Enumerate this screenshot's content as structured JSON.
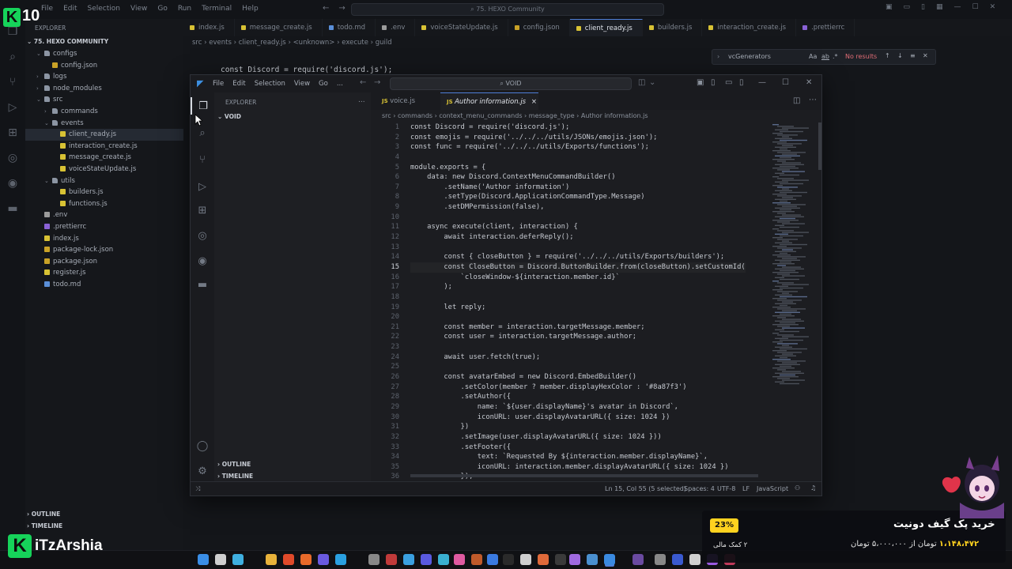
{
  "back_window": {
    "menu": [
      "File",
      "Edit",
      "Selection",
      "View",
      "Go",
      "Run",
      "Terminal",
      "Help"
    ],
    "search": "75. HEXO Community",
    "explorer_header": "EXPLORER",
    "project": "75. HEXO COMMUNITY",
    "tree": [
      {
        "label": "configs",
        "type": "folder",
        "depth": 1,
        "open": true
      },
      {
        "label": "config.json",
        "type": "json",
        "depth": 2
      },
      {
        "label": "logs",
        "type": "folder",
        "depth": 1
      },
      {
        "label": "node_modules",
        "type": "folder",
        "depth": 1
      },
      {
        "label": "src",
        "type": "folder",
        "depth": 1,
        "open": true
      },
      {
        "label": "commands",
        "type": "folder",
        "depth": 2
      },
      {
        "label": "events",
        "type": "folder",
        "depth": 2,
        "open": true
      },
      {
        "label": "client_ready.js",
        "type": "js",
        "depth": 3,
        "selected": true
      },
      {
        "label": "interaction_create.js",
        "type": "js",
        "depth": 3
      },
      {
        "label": "message_create.js",
        "type": "js",
        "depth": 3
      },
      {
        "label": "voiceStateUpdate.js",
        "type": "js",
        "depth": 3
      },
      {
        "label": "utils",
        "type": "folder",
        "depth": 2,
        "open": true
      },
      {
        "label": "builders.js",
        "type": "js",
        "depth": 3
      },
      {
        "label": "functions.js",
        "type": "js",
        "depth": 3
      },
      {
        "label": ".env",
        "type": "env",
        "depth": 1
      },
      {
        "label": ".prettierrc",
        "type": "other",
        "depth": 1
      },
      {
        "label": "index.js",
        "type": "js",
        "depth": 1
      },
      {
        "label": "package-lock.json",
        "type": "json",
        "depth": 1
      },
      {
        "label": "package.json",
        "type": "json",
        "depth": 1
      },
      {
        "label": "register.js",
        "type": "js",
        "depth": 1
      },
      {
        "label": "todo.md",
        "type": "md",
        "depth": 1
      }
    ],
    "outline": "OUTLINE",
    "timeline": "TIMELINE",
    "tabs": [
      {
        "label": "index.js",
        "type": "js"
      },
      {
        "label": "message_create.js",
        "type": "js"
      },
      {
        "label": "todo.md",
        "type": "md"
      },
      {
        "label": ".env",
        "type": "env"
      },
      {
        "label": "voiceStateUpdate.js",
        "type": "js"
      },
      {
        "label": "config.json",
        "type": "json"
      },
      {
        "label": "client_ready.js",
        "type": "js",
        "active": true
      },
      {
        "label": "builders.js",
        "type": "js"
      },
      {
        "label": "interaction_create.js",
        "type": "js"
      },
      {
        "label": ".prettierrc",
        "type": "other"
      }
    ],
    "breadcrumb": [
      "src",
      "events",
      "client_ready.js",
      "<unknown>",
      "execute",
      "guild"
    ],
    "code_line": "const Discord = require('discord.js');",
    "find": {
      "query": "vcGenerators",
      "case": "Aa",
      "word": "ab",
      "regex": ".*",
      "result": "No results"
    }
  },
  "front_window": {
    "menu": [
      "File",
      "Edit",
      "Selection",
      "View",
      "Go"
    ],
    "more": "...",
    "search": "VOID",
    "explorer_header": "EXPLORER",
    "explorer_more": "...",
    "root": "VOID",
    "outline": "OUTLINE",
    "timeline": "TIMELINE",
    "tabs": [
      {
        "label": "voice.js",
        "active": false
      },
      {
        "label": "Author information.js",
        "active": true,
        "close": "×"
      }
    ],
    "breadcrumb": [
      "src",
      "commands",
      "context_menu_commands",
      "message_type",
      "Author information.js"
    ],
    "lines": [
      {
        "n": "1",
        "t": "const Discord = require('discord.js');"
      },
      {
        "n": "2",
        "t": "const emojis = require('../../../utils/JSONs/emojis.json');"
      },
      {
        "n": "3",
        "t": "const func = require('../../../utils/Exports/functions');"
      },
      {
        "n": "4",
        "t": ""
      },
      {
        "n": "5",
        "t": "module.exports = {"
      },
      {
        "n": "6",
        "t": "    data: new Discord.ContextMenuCommandBuilder()"
      },
      {
        "n": "7",
        "t": "        .setName('Author information')"
      },
      {
        "n": "8",
        "t": "        .setType(Discord.ApplicationCommandType.Message)"
      },
      {
        "n": "9",
        "t": "        .setDMPermission(false),"
      },
      {
        "n": "10",
        "t": ""
      },
      {
        "n": "11",
        "t": "    async execute(client, interaction) {"
      },
      {
        "n": "12",
        "t": "        await interaction.deferReply();"
      },
      {
        "n": "13",
        "t": ""
      },
      {
        "n": "14",
        "t": "        const { closeButton } = require('../../../utils/Exports/builders');"
      },
      {
        "n": "15",
        "t": "        const CloseButton = Discord.ButtonBuilder.from(closeButton).setCustomId(",
        "current": true
      },
      {
        "n": "16",
        "t": "            `closeWindow-${interaction.member.id}`"
      },
      {
        "n": "17",
        "t": "        );"
      },
      {
        "n": "18",
        "t": ""
      },
      {
        "n": "19",
        "t": "        let reply;"
      },
      {
        "n": "20",
        "t": ""
      },
      {
        "n": "21",
        "t": "        const member = interaction.targetMessage.member;"
      },
      {
        "n": "22",
        "t": "        const user = interaction.targetMessage.author;"
      },
      {
        "n": "23",
        "t": ""
      },
      {
        "n": "24",
        "t": "        await user.fetch(true);"
      },
      {
        "n": "25",
        "t": ""
      },
      {
        "n": "26",
        "t": "        const avatarEmbed = new Discord.EmbedBuilder()"
      },
      {
        "n": "27",
        "t": "            .setColor(member ? member.displayHexColor : '#8a87f3')"
      },
      {
        "n": "28",
        "t": "            .setAuthor({"
      },
      {
        "n": "29",
        "t": "                name: `${user.displayName}'s avatar in Discord`,"
      },
      {
        "n": "30",
        "t": "                iconURL: user.displayAvatarURL({ size: 1024 })"
      },
      {
        "n": "31",
        "t": "            })"
      },
      {
        "n": "32",
        "t": "            .setImage(user.displayAvatarURL({ size: 1024 }))"
      },
      {
        "n": "33",
        "t": "            .setFooter({"
      },
      {
        "n": "34",
        "t": "                text: `Requested By ${interaction.member.displayName}`,"
      },
      {
        "n": "35",
        "t": "                iconURL: interaction.member.displayAvatarURL({ size: 1024 })"
      },
      {
        "n": "36",
        "t": "            });"
      }
    ],
    "status": {
      "position": "Ln 15, Col 55 (5 selected)",
      "spaces": "Spaces: 4",
      "encoding": "UTF-8",
      "eol": "LF",
      "language": "JavaScript"
    }
  },
  "overlay": {
    "channel_logo_letter": "K",
    "channel_number": "10",
    "brand_letter": "K",
    "brand_name": "iTzArshia",
    "promo": {
      "discount": "23%",
      "sub": "۲ کمک مالی",
      "title": "خرید پک گیف دونیت",
      "price_new": "۱،۱۴۸،۴۷۲",
      "price_mid": "تومان از",
      "price_old": "۵،۰۰۰،۰۰۰ تومان"
    }
  },
  "colors": {
    "accent": "#4f7fd8",
    "js": "#d8c234",
    "json": "#c9a227",
    "folder": "#8c95a3",
    "env": "#9b9b9b",
    "md": "#5a8fd8",
    "other": "#8a62d6",
    "brand_green": "#16d35a",
    "promo_yellow": "#ffd21f"
  }
}
